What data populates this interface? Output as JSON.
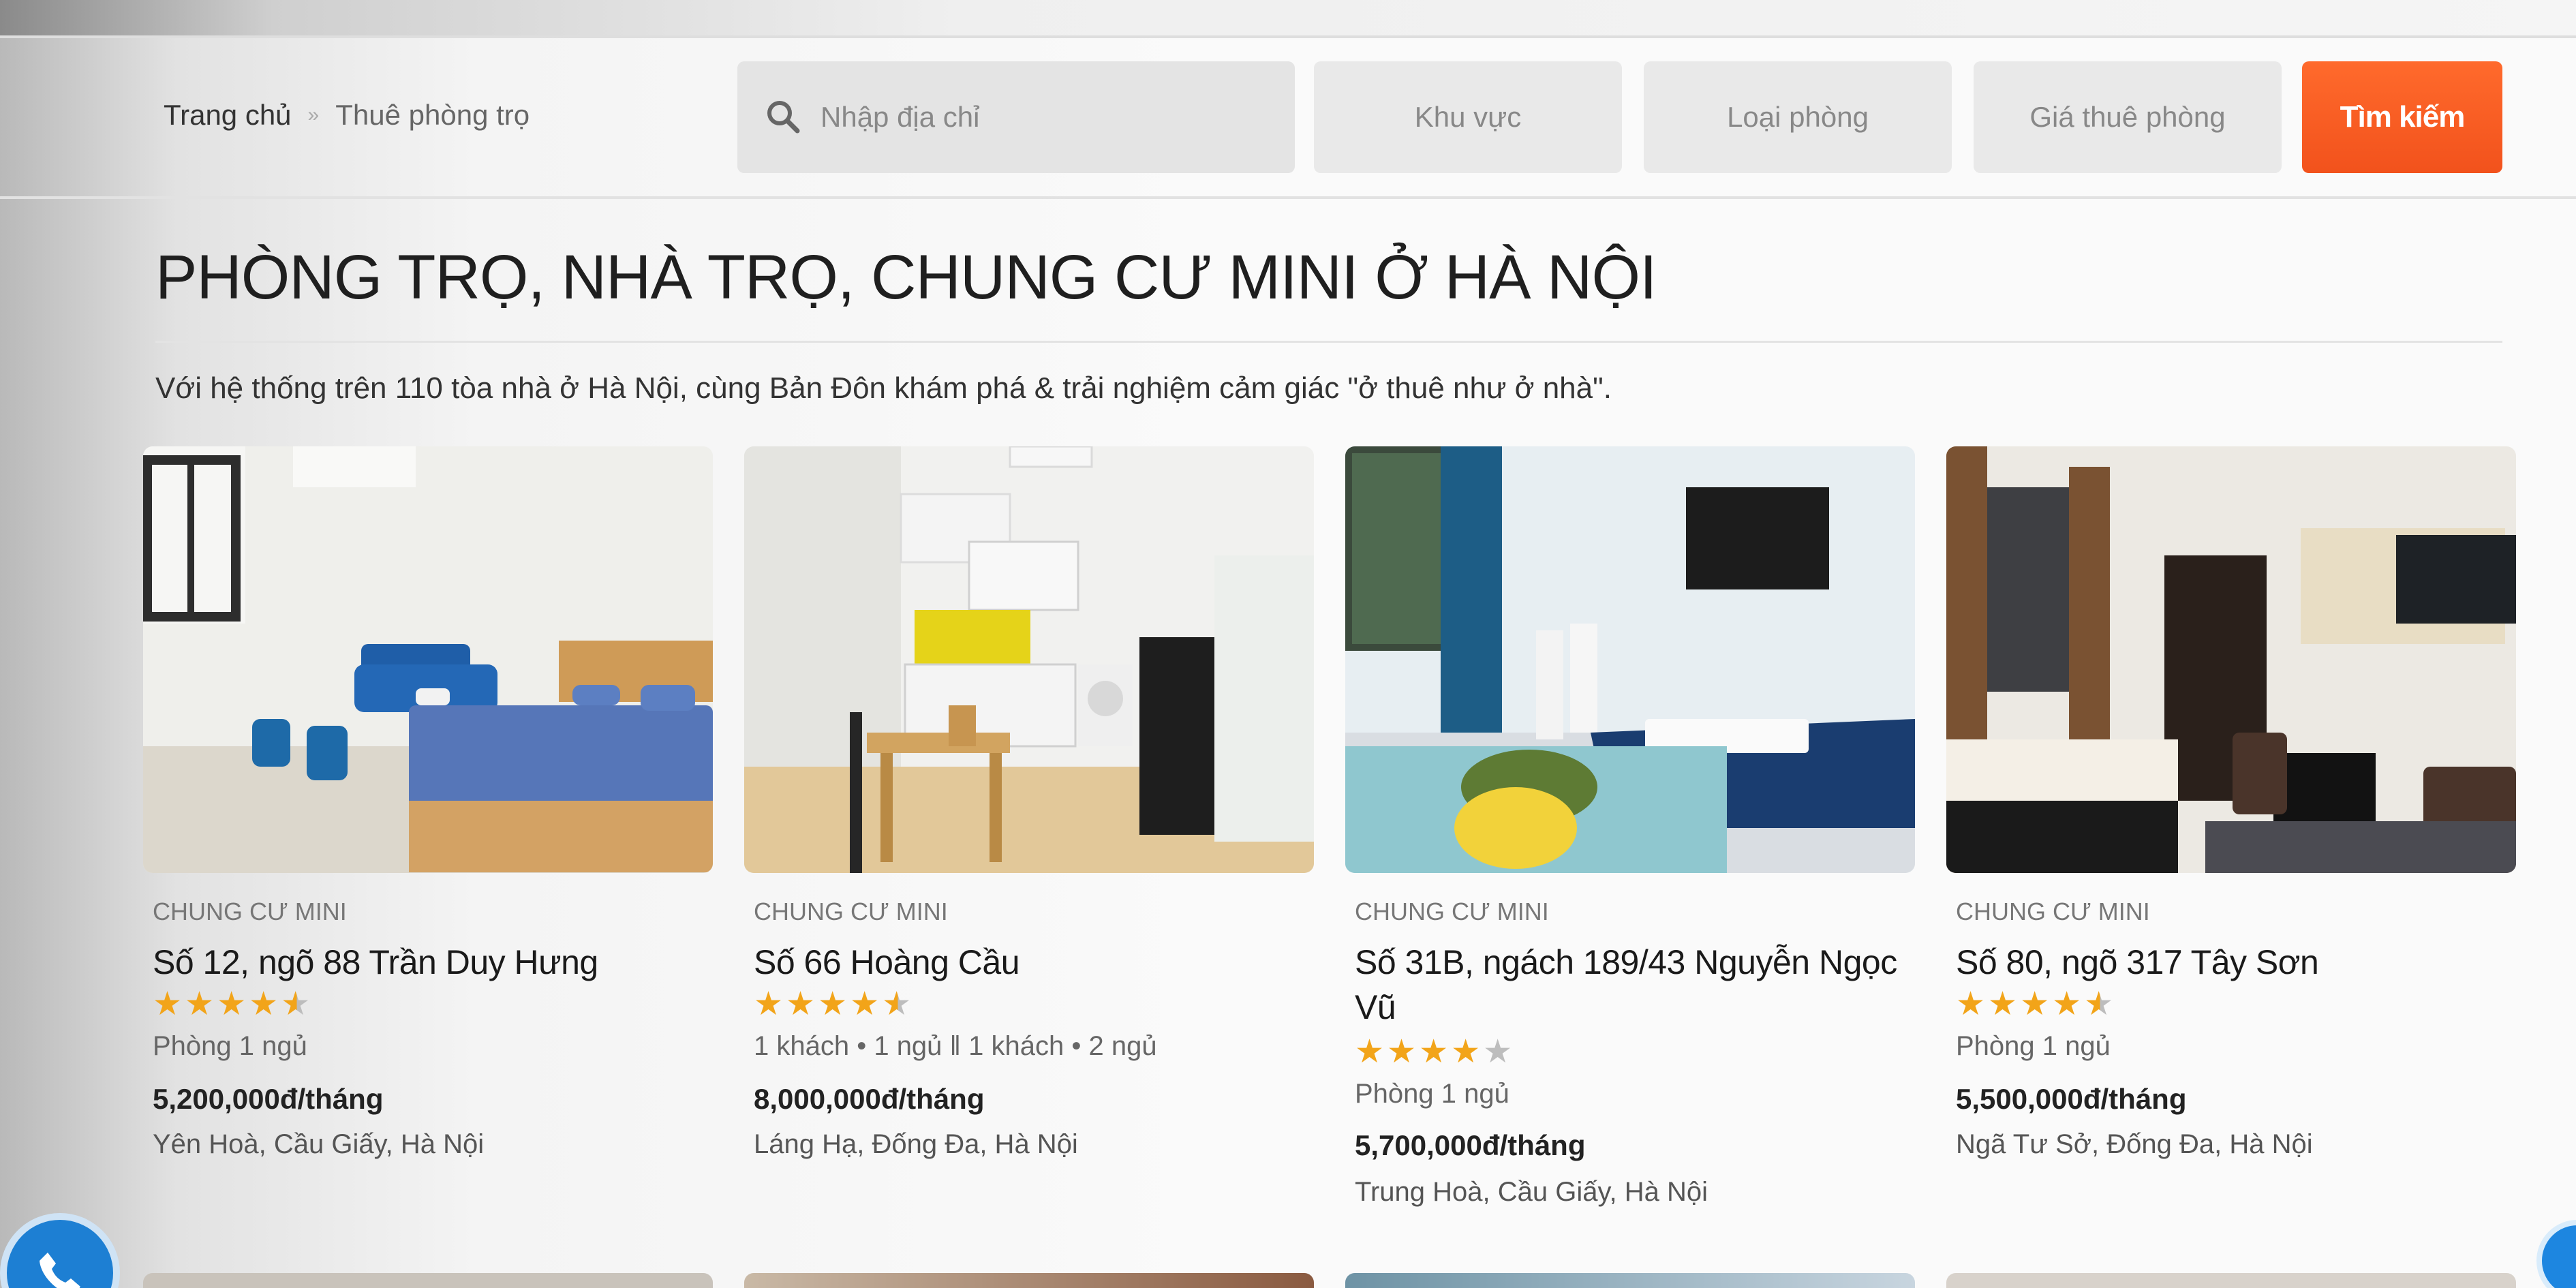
{
  "header": {
    "breadcrumb": [
      "Trang chủ",
      "Thuê phòng trọ"
    ],
    "breadcrumb_separator": "»"
  },
  "search": {
    "address_placeholder": "Nhập địa chỉ",
    "area_label": "Khu vực",
    "room_type_label": "Loại phòng",
    "price_label": "Giá thuê phòng",
    "submit_label": "Tìm kiếm",
    "submit_color": "#f2521c"
  },
  "main": {
    "title": "PHÒNG TRỌ, NHÀ TRỌ, CHUNG CƯ MINI Ở HÀ NỘI",
    "intro": "Với hệ thống trên 110 tòa nhà ở Hà Nội, cùng Bản Đôn khám phá & trải nghiệm cảm giác \"ở thuê như ở nhà\"."
  },
  "listings": [
    {
      "category": "CHUNG CƯ MINI",
      "address": "Số 12, ngõ 88 Trần Duy Hưng",
      "rating": 4.5,
      "stars": "★★★★★",
      "rooms": "Phòng 1 ngủ",
      "price": "5,200,000đ/tháng",
      "location": "Yên Hoà, Cầu Giấy, Hà Nội"
    },
    {
      "category": "CHUNG CƯ MINI",
      "address": "Số 66 Hoàng Cầu",
      "rating": 4.5,
      "stars": "★★★★★",
      "rooms": "1 khách • 1 ngủ ‖ 1 khách • 2 ngủ",
      "price": "8,000,000đ/tháng",
      "location": "Láng Hạ, Đống Đa, Hà Nội"
    },
    {
      "category": "CHUNG CƯ MINI",
      "address": "Số 31B, ngách 189/43 Nguyễn Ngọc Vũ",
      "rating": 4,
      "stars": "★★★★★",
      "rooms": "Phòng 1 ngủ",
      "price": "5,700,000đ/tháng",
      "location": "Trung Hoà, Cầu Giấy, Hà Nội"
    },
    {
      "category": "CHUNG CƯ MINI",
      "address": "Số 80, ngõ 317 Tây Sơn",
      "rating": 4.5,
      "stars": "★★★★★",
      "rooms": "Phòng 1 ngủ",
      "price": "5,500,000đ/tháng",
      "location": "Ngã Tư Sở, Đống Đa, Hà Nội"
    }
  ],
  "icons": {
    "search": "search-icon",
    "phone": "phone-icon",
    "star": "star-icon"
  },
  "colors": {
    "accent": "#f2521c",
    "star": "#f2a419",
    "call": "#1d7fd3"
  }
}
